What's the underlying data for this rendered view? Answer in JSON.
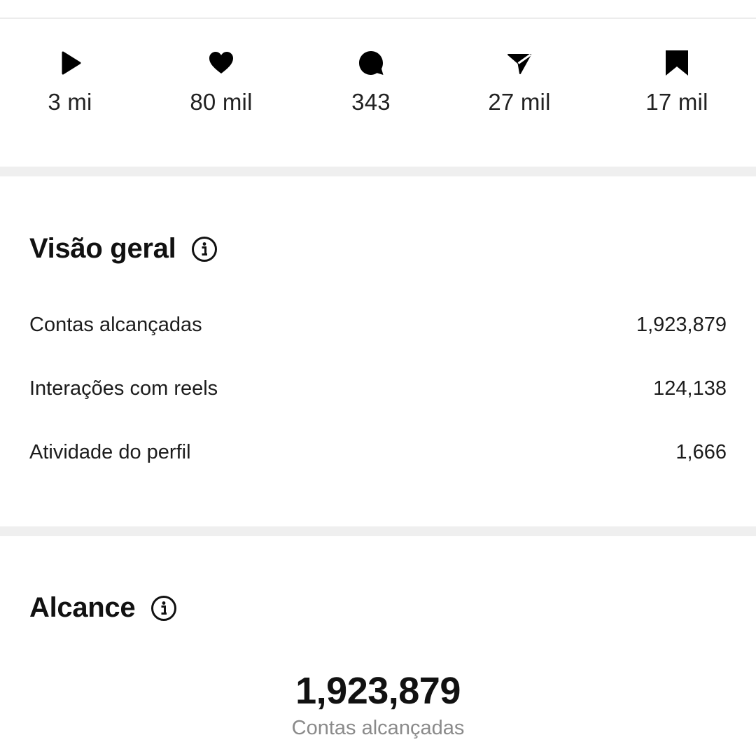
{
  "stats": [
    {
      "icon": "play-icon",
      "value": "3 mi"
    },
    {
      "icon": "heart-icon",
      "value": "80 mil"
    },
    {
      "icon": "comment-icon",
      "value": "343"
    },
    {
      "icon": "send-icon",
      "value": "27 mil"
    },
    {
      "icon": "bookmark-icon",
      "value": "17 mil"
    }
  ],
  "overview": {
    "title": "Visão geral",
    "info_icon": "info-icon",
    "rows": [
      {
        "label": "Contas alcançadas",
        "value": "1,923,879"
      },
      {
        "label": "Interações com reels",
        "value": "124,138"
      },
      {
        "label": "Atividade do perfil",
        "value": "1,666"
      }
    ]
  },
  "reach": {
    "title": "Alcance",
    "info_icon": "info-icon",
    "total": "1,923,879",
    "caption": "Contas alcançadas"
  }
}
